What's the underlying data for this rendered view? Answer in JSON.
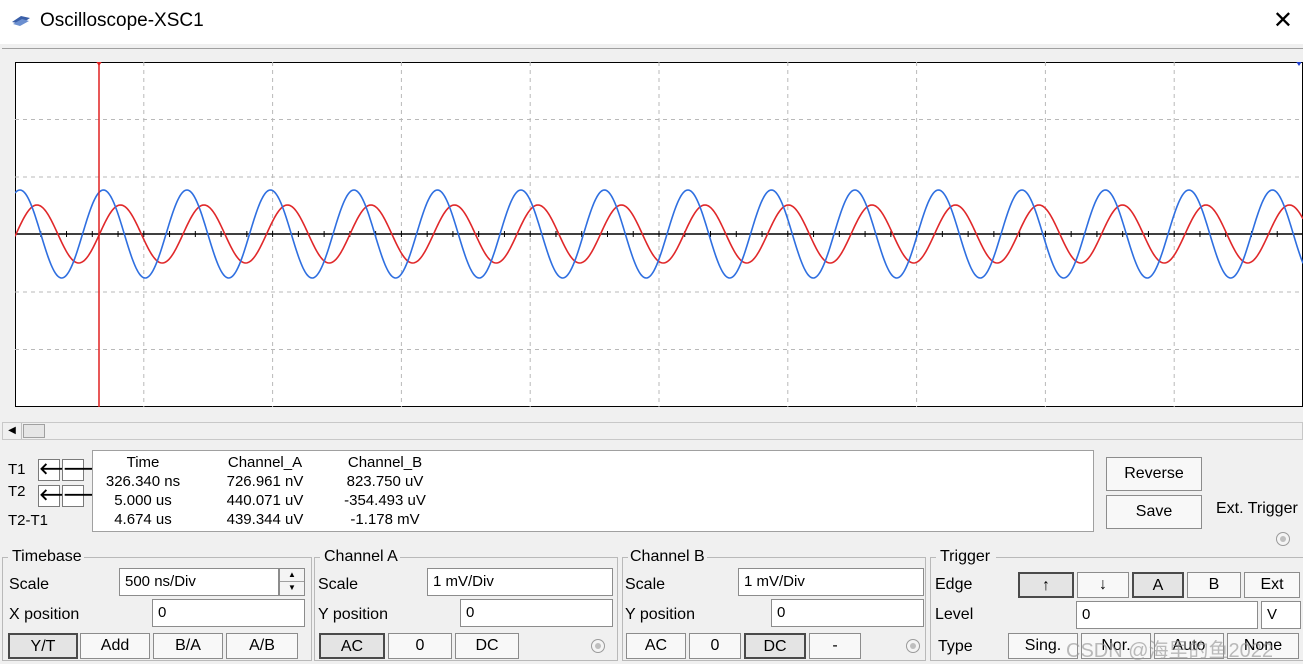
{
  "window": {
    "title": "Oscilloscope-XSC1",
    "close_glyph": "✕"
  },
  "screen": {
    "channel_a_color": "#e0282a",
    "channel_b_color": "#2f6fe0",
    "cursor_t1_color": "#e02020",
    "cursor_t2_color": "#1e3fd0",
    "grid_color": "#b9b9b9",
    "icons": {
      "t1_marker": "red-triangle-down-icon",
      "t2_marker": "blue-triangle-down-icon"
    }
  },
  "cursors": {
    "t1_label": "T1",
    "t2_label": "T2",
    "diff_label": "T2-T1",
    "left_arrow": "🡐",
    "right_arrow": "🡒"
  },
  "readout": {
    "headers": {
      "time": "Time",
      "channel_a": "Channel_A",
      "channel_b": "Channel_B"
    },
    "rows": [
      {
        "time": "326.340 ns",
        "channel_a": "726.961 nV",
        "channel_b": "823.750 uV"
      },
      {
        "time": "5.000 us",
        "channel_a": "440.071 uV",
        "channel_b": "-354.493 uV"
      },
      {
        "time": "4.674 us",
        "channel_a": "439.344 uV",
        "channel_b": "-1.178 mV"
      }
    ]
  },
  "buttons": {
    "reverse": "Reverse",
    "save": "Save",
    "ext_trigger": "Ext. Trigger"
  },
  "timebase": {
    "title": "Timebase",
    "scale_label": "Scale",
    "scale_value": "500 ns/Div",
    "xpos_label": "X position",
    "xpos_value": "0",
    "modes": [
      "Y/T",
      "Add",
      "B/A",
      "A/B"
    ],
    "selected_mode": "Y/T"
  },
  "channel_a": {
    "title": "Channel A",
    "scale_label": "Scale",
    "scale_value": "1 mV/Div",
    "ypos_label": "Y position",
    "ypos_value": "0",
    "coupling": [
      "AC",
      "0",
      "DC"
    ],
    "selected": "AC"
  },
  "channel_b": {
    "title": "Channel B",
    "scale_label": "Scale",
    "scale_value": "1 mV/Div",
    "ypos_label": "Y position",
    "ypos_value": "0",
    "coupling": [
      "AC",
      "0",
      "DC",
      "-"
    ],
    "selected": "DC"
  },
  "trigger": {
    "title": "Trigger",
    "edge_label": "Edge",
    "edges": [
      "↑",
      "↓",
      "A",
      "B",
      "Ext"
    ],
    "selected_edge": "↑",
    "level_label": "Level",
    "level_value": "0",
    "level_unit": "V",
    "type_label": "Type",
    "types": [
      "Sing.",
      "Nor.",
      "Auto",
      "None"
    ]
  },
  "watermark": "CSDN @海里的鱼2022"
}
